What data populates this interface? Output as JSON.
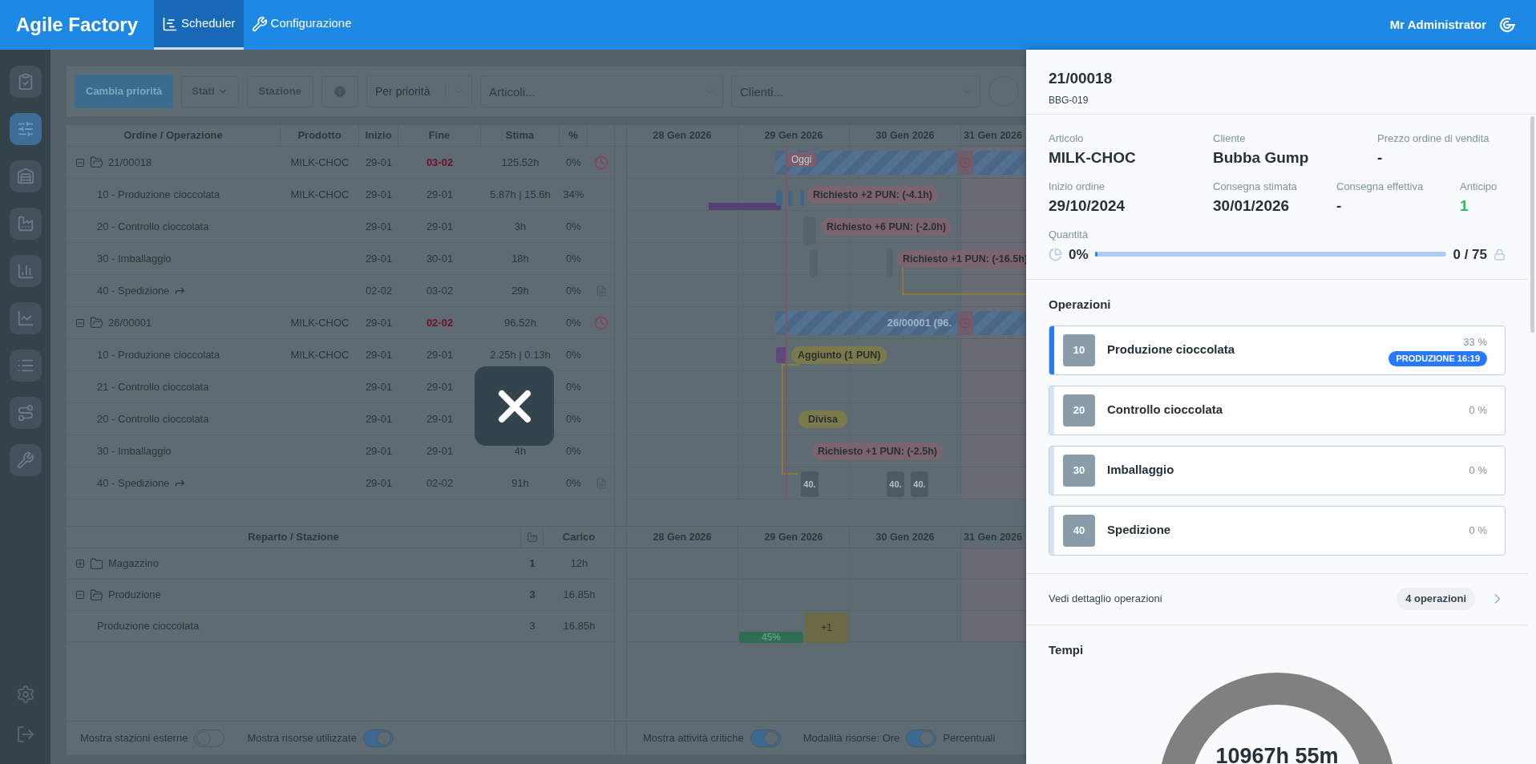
{
  "app": {
    "title": "Agile Factory",
    "user": "Mr Administrator"
  },
  "nav_tabs": [
    {
      "label": "Scheduler",
      "selected": true
    },
    {
      "label": "Configurazione",
      "selected": false
    }
  ],
  "sidebar": {
    "items": [
      {
        "selected": false
      },
      {
        "selected": true
      },
      {
        "selected": false
      },
      {
        "selected": false
      },
      {
        "selected": false
      },
      {
        "selected": false
      },
      {
        "selected": false
      },
      {
        "selected": false
      },
      {
        "selected": false
      }
    ]
  },
  "toolbar": {
    "primary_button": "Cambia priorità",
    "states_button": "Stati",
    "station_button": "Stazione",
    "sort_select": "Per priorità",
    "articles_placeholder": "Articoli...",
    "clients_placeholder": "Clienti..."
  },
  "orders_table": {
    "columns": [
      "Ordine / Operazione",
      "Prodotto",
      "Inizio",
      "Fine",
      "Stima",
      "%"
    ],
    "rows": [
      {
        "kind": "order",
        "expanded": true,
        "name": "21/00018",
        "product": "MILK-CHOC",
        "start": "29-01",
        "end": "03-02",
        "late": true,
        "estimate": "125.52h",
        "percent": "0%",
        "forwarded": false,
        "note": false
      },
      {
        "kind": "operation",
        "name": "10 - Produzione cioccolata",
        "product": "MILK-CHOC",
        "start": "29-01",
        "end": "29-01",
        "late": false,
        "estimate": "5.87h | 15.6h",
        "percent": "34%",
        "forwarded": false,
        "note": false
      },
      {
        "kind": "operation",
        "name": "20 - Controllo cioccolata",
        "start": "29-01",
        "end": "29-01",
        "late": false,
        "estimate": "3h",
        "percent": "0%",
        "forwarded": false,
        "note": false
      },
      {
        "kind": "operation",
        "name": "30 - Imballaggio",
        "start": "29-01",
        "end": "30-01",
        "late": false,
        "estimate": "18h",
        "percent": "0%",
        "forwarded": false,
        "note": false
      },
      {
        "kind": "operation",
        "name": "40 - Spedizione",
        "start": "02-02",
        "end": "03-02",
        "late": false,
        "estimate": "29h",
        "percent": "0%",
        "forwarded": true,
        "note": true
      },
      {
        "kind": "order",
        "expanded": true,
        "name": "26/00001",
        "product": "MILK-CHOC",
        "start": "29-01",
        "end": "02-02",
        "late": true,
        "estimate": "96.52h",
        "percent": "0%",
        "forwarded": false,
        "note": false
      },
      {
        "kind": "operation",
        "name": "10 - Produzione cioccolata",
        "product": "MILK-CHOC",
        "start": "29-01",
        "end": "29-01",
        "late": false,
        "estimate": "2.25h | 0.13h",
        "percent": "0%",
        "forwarded": false,
        "note": false
      },
      {
        "kind": "operation",
        "name": "21 - Controllo cioccolata",
        "start": "29-01",
        "end": "29-01",
        "late": false,
        "percent": "0%",
        "forwarded": false,
        "note": false
      },
      {
        "kind": "operation",
        "name": "20 - Controllo cioccolata",
        "start": "29-01",
        "end": "29-01",
        "late": false,
        "percent": "0%",
        "forwarded": false,
        "note": false
      },
      {
        "kind": "operation",
        "name": "30 - Imballaggio",
        "start": "29-01",
        "end": "29-01",
        "late": false,
        "estimate": "4h",
        "percent": "0%",
        "forwarded": false,
        "note": false
      },
      {
        "kind": "operation",
        "name": "40 - Spedizione",
        "start": "29-01",
        "end": "02-02",
        "late": false,
        "estimate": "91h",
        "percent": "0%",
        "forwarded": true,
        "note": true
      }
    ]
  },
  "order_gantt_days": [
    "28 Gen 2026",
    "29 Gen 2026",
    "30 Gen 2026",
    "31 Gen 2026"
  ],
  "station_gantt_days": [
    "28 Gen 2026",
    "29 Gen 2026",
    "30 Gen 2026",
    "31 Gen 2026"
  ],
  "order_gantt": [
    {
      "kind": "summary"
    },
    {
      "kind": "today",
      "text": "Oggi"
    },
    {
      "kind": "requested",
      "text": "Richiesto +2 PUN: (-4.1h)"
    },
    {
      "kind": "requested",
      "text": "Richiesto +6 PUN: (-2.0h)"
    },
    {
      "kind": "requested",
      "text": "Richiesto +1 PUN: (-16.5h)"
    },
    {
      "kind": "summary",
      "text": "26/00001 (96."
    },
    {
      "kind": "added",
      "text": "Aggiunto (1 PUN)"
    },
    {
      "kind": "split",
      "text": "Divisa"
    },
    {
      "kind": "requested",
      "text": "Richiesto +1 PUN: (-2.5h)"
    },
    {
      "kind": "segment",
      "text": "40."
    },
    {
      "kind": "segment",
      "text": "40."
    },
    {
      "kind": "segment",
      "text": "40."
    }
  ],
  "stations_table": {
    "columns": [
      "Reparto / Stazione",
      "Carico"
    ],
    "rows": [
      {
        "kind": "group",
        "expanded": false,
        "name": "Magazzino",
        "count": "1",
        "load": "12h"
      },
      {
        "kind": "group",
        "expanded": true,
        "name": "Produzione",
        "count": "3",
        "load": "16.85h"
      },
      {
        "kind": "station",
        "name": "Produzione cioccolata",
        "count": "3",
        "load": "16.85h"
      }
    ]
  },
  "station_gantt": [
    {
      "kind": "load",
      "text": "45%"
    },
    {
      "kind": "overload",
      "text": "+1"
    }
  ],
  "footer_left": [
    {
      "label": "Mostra stazioni esterne",
      "on": false
    },
    {
      "label": "Mostra risorse utilizzate",
      "on": true
    }
  ],
  "footer_right": {
    "critical": {
      "label": "Mostra attività critiche",
      "on": true
    },
    "mode": {
      "left": "Modalità risorse: Ore",
      "right": "Percentuali",
      "on": true
    }
  },
  "drawer": {
    "title": "21/00018",
    "subtitle": "BBG-019",
    "field_rows": [
      {
        "fields": [
          {
            "label": "Articolo",
            "value": "MILK-CHOC",
            "color": "#263238"
          },
          {
            "label": "Cliente",
            "value": "Bubba Gump",
            "color": "#263238"
          },
          {
            "label": "Prezzo ordine di vendita",
            "value": "-",
            "color": "#263238"
          }
        ]
      },
      {
        "fields": [
          {
            "label": "Inizio ordine",
            "value": "29/10/2024",
            "color": "#263238"
          },
          {
            "label": "Consegna stimata",
            "value": "30/01/2026",
            "color": "#263238"
          },
          {
            "label": "Consegna effettiva",
            "value": "-",
            "color": "#263238"
          },
          {
            "label": "Anticipo",
            "value": "1",
            "color": "#22c55e"
          }
        ]
      }
    ],
    "quantity": {
      "label": "Quantità",
      "percent": "0%",
      "level": 0,
      "count": "0 / 75"
    },
    "operations_title": "Operazioni",
    "operations": [
      {
        "code": "10",
        "name": "Produzione cioccolata",
        "percent": "33 %",
        "selected": true,
        "badge": "PRODUZIONE 16:19"
      },
      {
        "code": "20",
        "name": "Controllo cioccolata",
        "percent": "0 %",
        "selected": false
      },
      {
        "code": "30",
        "name": "Imballaggio",
        "percent": "0 %",
        "selected": false
      },
      {
        "code": "40",
        "name": "Spedizione",
        "percent": "0 %",
        "selected": false
      }
    ],
    "details_link": {
      "label": "Vedi dettaglio operazioni",
      "count": "4 operazioni"
    },
    "times": {
      "title": "Tempi",
      "total": "10967h 55m"
    }
  }
}
